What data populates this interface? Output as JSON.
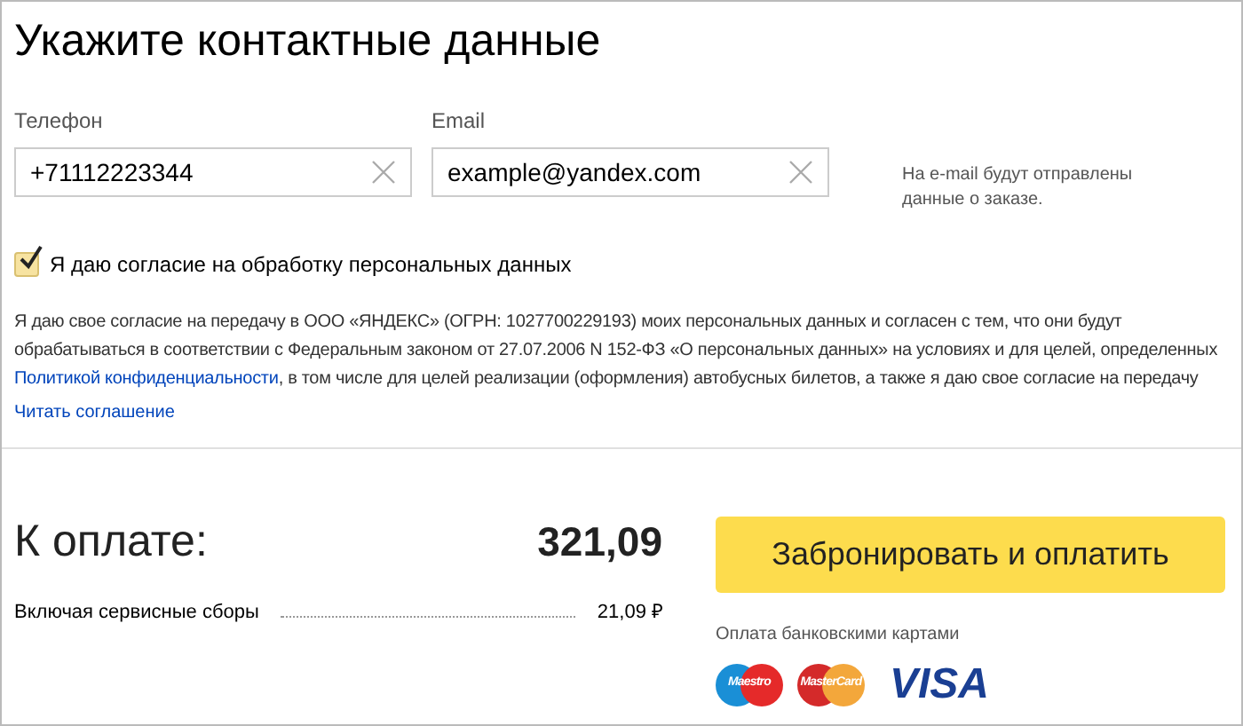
{
  "title": "Укажите контактные данные",
  "fields": [
    {
      "label": "Телефон",
      "value": "+71112223344"
    },
    {
      "label": "Email",
      "value": "example@yandex.com"
    }
  ],
  "email_note": "На e-mail будут отправлены данные о заказе.",
  "consent": {
    "label": "Я даю согласие на обработку персональных данных",
    "checked": true
  },
  "agreement": {
    "text_before": "Я даю свое согласие на передачу в ООО «ЯНДЕКС» (ОГРН: 1027700229193) моих персональных данных и согласен с тем, что они будут обрабатываться в соответствии с Федеральным законом от 27.07.2006 N 152-ФЗ «О персональных данных» на условиях и для целей, определенных ",
    "link": "Политикой конфиденциальности",
    "text_after": ", в том числе для целей реализации (оформления) автобусных билетов, а также я даю свое согласие на передачу",
    "read_link": "Читать соглашение"
  },
  "payment": {
    "label": "К оплате:",
    "total": "321,09",
    "fee_label": "Включая сервисные сборы",
    "fee_value": "21,09 ₽",
    "button": "Забронировать и оплатить",
    "cards_note": "Оплата банковскими картами",
    "cards": [
      {
        "kind": "maestro",
        "label": "Maestro"
      },
      {
        "kind": "mastercard",
        "label": "MasterCard"
      },
      {
        "kind": "visa",
        "label": "VISA"
      }
    ]
  }
}
